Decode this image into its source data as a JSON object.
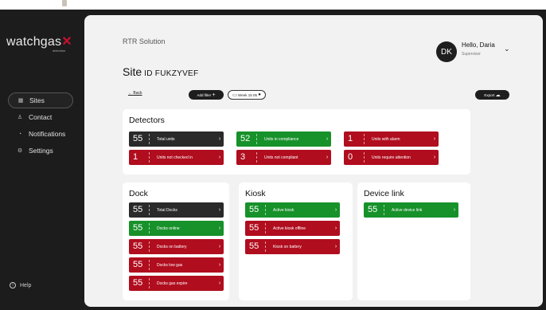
{
  "sidebar": {
    "logo": "watchgas",
    "logo_sub": "detection",
    "items": [
      {
        "label": "Sites",
        "icon": "grid-icon"
      },
      {
        "label": "Contact",
        "icon": "user-icon"
      },
      {
        "label": "Notifications",
        "icon": "bell-icon"
      },
      {
        "label": "Settings",
        "icon": "gear-icon"
      }
    ],
    "help": "Help"
  },
  "header": {
    "company": "RTR Solution",
    "site_label": "Site",
    "site_id": "ID FUKZYVEF",
    "avatar": "DK",
    "greeting": "Hello, Daria",
    "role": "Supervisor"
  },
  "toolbar": {
    "back": "Back",
    "add_filter": "Add filter",
    "date_filter": "Week 15 05",
    "export": "Export"
  },
  "detectors": {
    "title": "Detectors",
    "tiles": [
      {
        "value": "55",
        "label": "Total units",
        "color": "dark"
      },
      {
        "value": "52",
        "label": "Units in compliance",
        "color": "green"
      },
      {
        "value": "1",
        "label": "Units with alarm",
        "color": "red"
      },
      {
        "value": "1",
        "label": "Units not checked in",
        "color": "red"
      },
      {
        "value": "3",
        "label": "Units not compliant",
        "color": "red"
      },
      {
        "value": "0",
        "label": "Units require attention",
        "color": "red"
      }
    ]
  },
  "dock": {
    "title": "Dock",
    "tiles": [
      {
        "value": "55",
        "label": "Total Docks",
        "color": "dark"
      },
      {
        "value": "55",
        "label": "Docks online",
        "color": "green"
      },
      {
        "value": "55",
        "label": "Docks on battery",
        "color": "red"
      },
      {
        "value": "55",
        "label": "Docks low gas",
        "color": "red"
      },
      {
        "value": "55",
        "label": "Docks gas expire",
        "color": "red"
      }
    ]
  },
  "kiosk": {
    "title": "Kiosk",
    "tiles": [
      {
        "value": "55",
        "label": "Active kiosk",
        "color": "green"
      },
      {
        "value": "55",
        "label": "Active kiosk offline",
        "color": "red"
      },
      {
        "value": "55",
        "label": "Kiosk on battery",
        "color": "red"
      }
    ]
  },
  "device_link": {
    "title": "Device link",
    "tiles": [
      {
        "value": "55",
        "label": "Active device link",
        "color": "green"
      }
    ]
  },
  "colors": {
    "dark": "#2a2a2a",
    "green": "#17912a",
    "red": "#b00d1e",
    "brand_accent": "#c8102e"
  }
}
